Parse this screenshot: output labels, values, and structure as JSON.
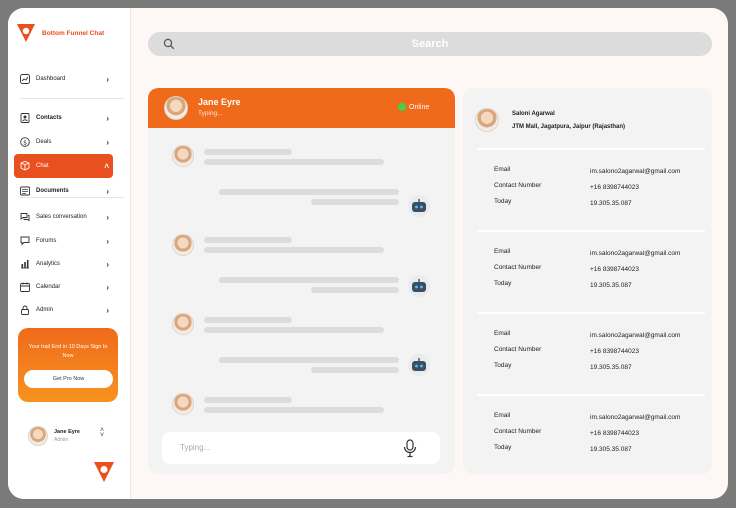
{
  "brand": {
    "name": "Bottom Funnel Chat",
    "accent": "#e8501f"
  },
  "sidebar": {
    "items": [
      {
        "label": "Dashboard",
        "icon": "chart-icon"
      },
      {
        "label": "Contacts",
        "icon": "contacts-icon"
      },
      {
        "label": "Deals",
        "icon": "dollar-icon"
      },
      {
        "label": "Chat",
        "icon": "chat-icon",
        "active": true
      },
      {
        "label": "Documents",
        "icon": "document-icon"
      },
      {
        "label": "Sales conversation",
        "icon": "conversation-icon"
      },
      {
        "label": "Forums",
        "icon": "forum-icon"
      },
      {
        "label": "Analytics",
        "icon": "analytics-icon"
      },
      {
        "label": "Calendar",
        "icon": "calendar-icon"
      },
      {
        "label": "Admin",
        "icon": "lock-icon"
      }
    ]
  },
  "promo": {
    "text": "Your trail End in 10 Days Sign In Now",
    "button": "Get Pro Now"
  },
  "user": {
    "name": "Jane Eyre",
    "role": "Admin"
  },
  "search": {
    "placeholder": "Search"
  },
  "chat": {
    "contact_name": "Jane Eyre",
    "status_text": "Typing...",
    "online_label": "Online",
    "compose_placeholder": "Typing..."
  },
  "details": {
    "name": "Saloni Agarwal",
    "address": "JTM Mall, Jagatpura, Jaipur (Rajasthan)",
    "cards": [
      {
        "email_label": "Email",
        "email": "im.salono2agarwal@gmail.com",
        "phone_label": "Contact Number",
        "phone": "+16 8398744023",
        "today_label": "Today",
        "today": "19.305.35.087"
      },
      {
        "email_label": "Email",
        "email": "im.salono2agarwal@gmail.com",
        "phone_label": "Contact Number",
        "phone": "+16 8398744023",
        "today_label": "Today",
        "today": "19.305.35.087"
      },
      {
        "email_label": "Email",
        "email": "im.salono2agarwal@gmail.com",
        "phone_label": "Contact Number",
        "phone": "+16 8398744023",
        "today_label": "Today",
        "today": "19.305.35.087"
      },
      {
        "email_label": "Email",
        "email": "im.salono2agarwal@gmail.com",
        "phone_label": "Contact Number",
        "phone": "+16 8398744023",
        "today_label": "Today",
        "today": "19.305.35.087"
      }
    ]
  }
}
